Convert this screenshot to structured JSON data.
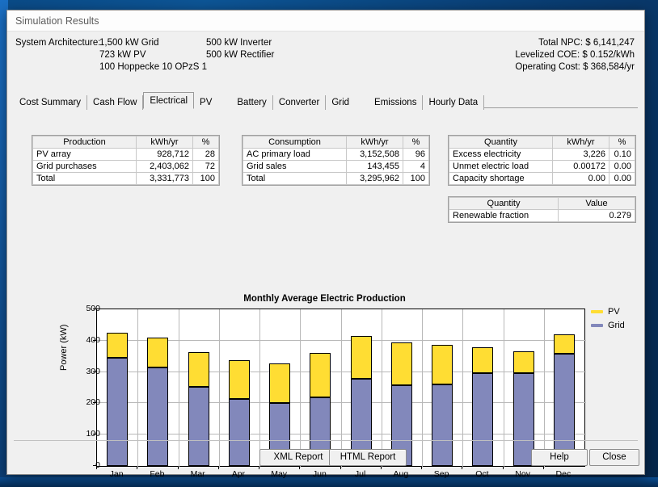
{
  "window": {
    "title": "Simulation Results"
  },
  "architecture": {
    "label": "System Architecture:",
    "col1": [
      "1,500 kW Grid",
      "723 kW PV",
      "100 Hoppecke 10 OPzS 1"
    ],
    "col2": [
      "500 kW Inverter",
      "500 kW Rectifier"
    ]
  },
  "summary": [
    "Total NPC:  $ 6,141,247",
    "Levelized COE:  $ 0.152/kWh",
    "Operating Cost:  $ 368,584/yr"
  ],
  "tabs": [
    {
      "label": "Cost Summary",
      "active": false
    },
    {
      "label": "Cash Flow",
      "active": false
    },
    {
      "label": "Electrical",
      "active": true
    },
    {
      "label": "PV",
      "active": false
    },
    {
      "label": "Battery",
      "active": false
    },
    {
      "label": "Converter",
      "active": false
    },
    {
      "label": "Grid",
      "active": false
    },
    {
      "label": "Emissions",
      "active": false
    },
    {
      "label": "Hourly Data",
      "active": false
    }
  ],
  "production_table": {
    "headers": [
      "Production",
      "kWh/yr",
      "%"
    ],
    "rows": [
      [
        "PV array",
        "928,712",
        "28"
      ],
      [
        "Grid purchases",
        "2,403,062",
        "72"
      ],
      [
        "Total",
        "3,331,773",
        "100"
      ]
    ]
  },
  "consumption_table": {
    "headers": [
      "Consumption",
      "kWh/yr",
      "%"
    ],
    "rows": [
      [
        "AC primary load",
        "3,152,508",
        "96"
      ],
      [
        "Grid sales",
        "143,455",
        "4"
      ],
      [
        "Total",
        "3,295,962",
        "100"
      ]
    ]
  },
  "quantity_table": {
    "headers": [
      "Quantity",
      "kWh/yr",
      "%"
    ],
    "rows": [
      [
        "Excess electricity",
        "3,226",
        "0.10"
      ],
      [
        "Unmet electric load",
        "0.00172",
        "0.00"
      ],
      [
        "Capacity shortage",
        "0.00",
        "0.00"
      ]
    ]
  },
  "value_table": {
    "headers": [
      "Quantity",
      "Value"
    ],
    "rows": [
      [
        "Renewable fraction",
        "0.279"
      ]
    ]
  },
  "buttons": {
    "xml_report": "XML Report",
    "html_report": "HTML Report",
    "help": "Help",
    "close": "Close"
  },
  "colors": {
    "pv": "#ffdd33",
    "grid": "#8288bb"
  },
  "chart_data": {
    "type": "bar",
    "stacked": true,
    "title": "Monthly Average Electric Production",
    "xlabel": "",
    "ylabel": "Power (kW)",
    "ylim": [
      0,
      500
    ],
    "yticks": [
      0,
      100,
      200,
      300,
      400,
      500
    ],
    "grid": true,
    "legend_position": "right",
    "categories": [
      "Jan",
      "Feb",
      "Mar",
      "Apr",
      "May",
      "Jun",
      "Jul",
      "Aug",
      "Sep",
      "Oct",
      "Nov",
      "Dec"
    ],
    "series": [
      {
        "name": "Grid",
        "color": "#8288bb",
        "values": [
          346,
          315,
          253,
          215,
          202,
          219,
          279,
          259,
          261,
          297,
          297,
          358
        ]
      },
      {
        "name": "PV",
        "color": "#ffdd33",
        "values": [
          78,
          91,
          107,
          121,
          123,
          140,
          134,
          132,
          123,
          80,
          67,
          60
        ]
      }
    ],
    "totals": [
      424,
      406,
      360,
      336,
      325,
      359,
      413,
      391,
      384,
      377,
      364,
      418
    ]
  }
}
